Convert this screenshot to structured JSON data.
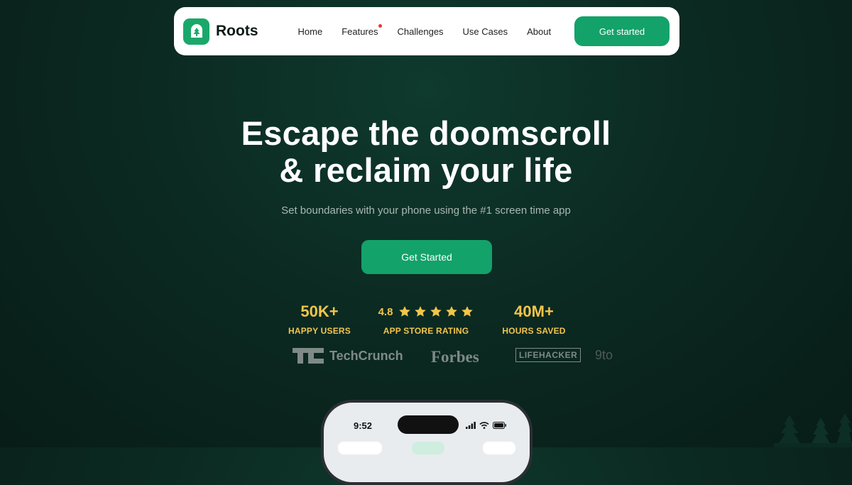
{
  "nav": {
    "brand": "Roots",
    "links": [
      "Home",
      "Features",
      "Challenges",
      "Use Cases",
      "About"
    ],
    "cta": "Get started"
  },
  "hero": {
    "title_line1": "Escape the doomscroll",
    "title_line2": "& reclaim your life",
    "subtitle": "Set boundaries with your phone using the #1 screen time app",
    "cta": "Get Started"
  },
  "stats": [
    {
      "value": "50K+",
      "label": "HAPPY USERS"
    },
    {
      "value": "4.8",
      "label": "APP STORE RATING",
      "stars": 5
    },
    {
      "value": "40M+",
      "label": "HOURS SAVED"
    }
  ],
  "press": {
    "techcrunch": "TechCrunch",
    "forbes": "Forbes",
    "lifehacker": "LIFEHACKER",
    "partial": "9to"
  },
  "phone": {
    "time": "9:52"
  },
  "colors": {
    "brand_green": "#13a26a",
    "accent_yellow": "#f3c54a",
    "background": "#0b2a22"
  }
}
